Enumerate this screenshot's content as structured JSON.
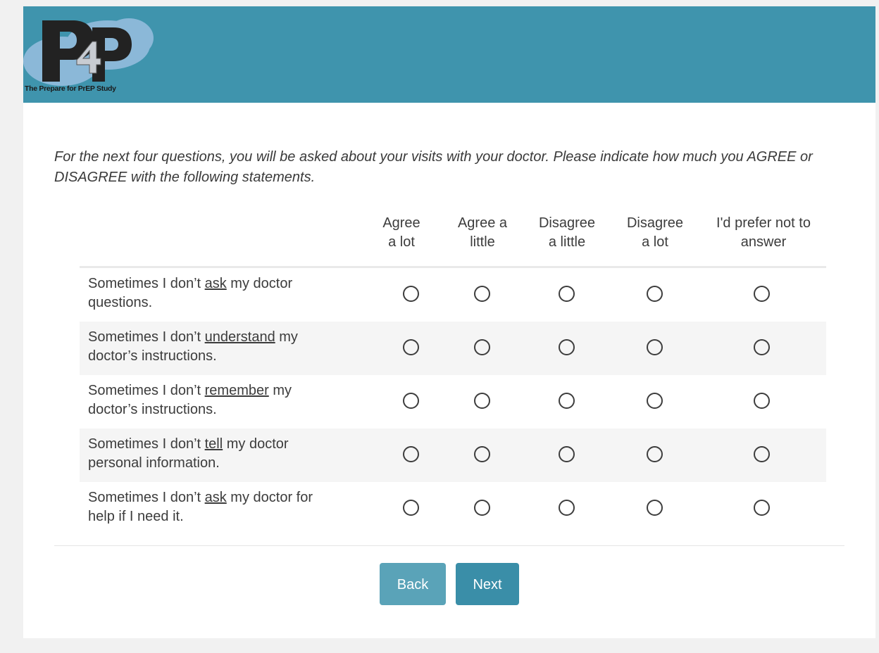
{
  "header": {
    "logo_text": "P4P",
    "logo_caption": "The Prepare for PrEP Study",
    "banner_color": "#3f94ad"
  },
  "intro": "For the next four questions, you will be asked about your visits with your doctor. Please indicate how much you AGREE or DISAGREE with the following statements.",
  "columns": [
    {
      "line1": "Agree",
      "line2": "a lot"
    },
    {
      "line1": "Agree a",
      "line2": "little"
    },
    {
      "line1": "Disagree",
      "line2": "a little"
    },
    {
      "line1": "Disagree",
      "line2": "a lot"
    },
    {
      "line1": "I'd prefer not to",
      "line2": "answer"
    }
  ],
  "rows": [
    {
      "pre": "Sometimes I don’t ",
      "key": "ask",
      "post": " my doctor",
      "line2": "questions."
    },
    {
      "pre": "Sometimes I don’t ",
      "key": "understand",
      "post": " my",
      "line2": "doctor’s instructions."
    },
    {
      "pre": "Sometimes I don’t ",
      "key": "remember",
      "post": " my",
      "line2": "doctor’s instructions."
    },
    {
      "pre": "Sometimes I don’t ",
      "key": "tell",
      "post": " my doctor",
      "line2": "personal information."
    },
    {
      "pre": "Sometimes I don’t ",
      "key": "ask",
      "post": " my doctor for",
      "line2": "help if I need it."
    }
  ],
  "buttons": {
    "back_label": "Back",
    "next_label": "Next"
  }
}
